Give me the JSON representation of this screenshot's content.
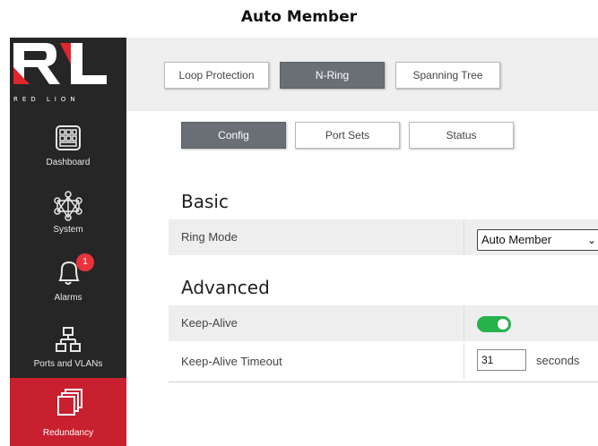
{
  "caption": "Auto Member",
  "brand": {
    "logo_text": "RED LION",
    "colors": {
      "sidebar": "#262626",
      "active": "#c8202e",
      "toggle_on": "#28b24b",
      "selected_button": "#6a6f75"
    }
  },
  "sidebar": {
    "items": [
      {
        "label": "Dashboard",
        "icon": "dashboard-grid-icon"
      },
      {
        "label": "System",
        "icon": "network-hub-icon"
      },
      {
        "label": "Alarms",
        "icon": "bell-icon",
        "badge": "1"
      },
      {
        "label": "Ports and VLANs",
        "icon": "network-tree-icon"
      },
      {
        "label": "Redundancy",
        "icon": "stacked-windows-icon",
        "active": true
      }
    ]
  },
  "top_tabs": [
    {
      "label": "Loop Protection",
      "selected": false
    },
    {
      "label": "N-Ring",
      "selected": true
    },
    {
      "label": "Spanning Tree",
      "selected": false
    }
  ],
  "sub_tabs": [
    {
      "label": "Config",
      "selected": true
    },
    {
      "label": "Port Sets",
      "selected": false
    },
    {
      "label": "Status",
      "selected": false
    }
  ],
  "basic": {
    "title": "Basic",
    "ring_mode_label": "Ring Mode",
    "ring_mode_value": "Auto Member"
  },
  "advanced": {
    "title": "Advanced",
    "keep_alive_label": "Keep-Alive",
    "keep_alive_on": true,
    "keep_alive_timeout_label": "Keep-Alive Timeout",
    "keep_alive_timeout_value": "31",
    "keep_alive_timeout_unit": "seconds"
  }
}
